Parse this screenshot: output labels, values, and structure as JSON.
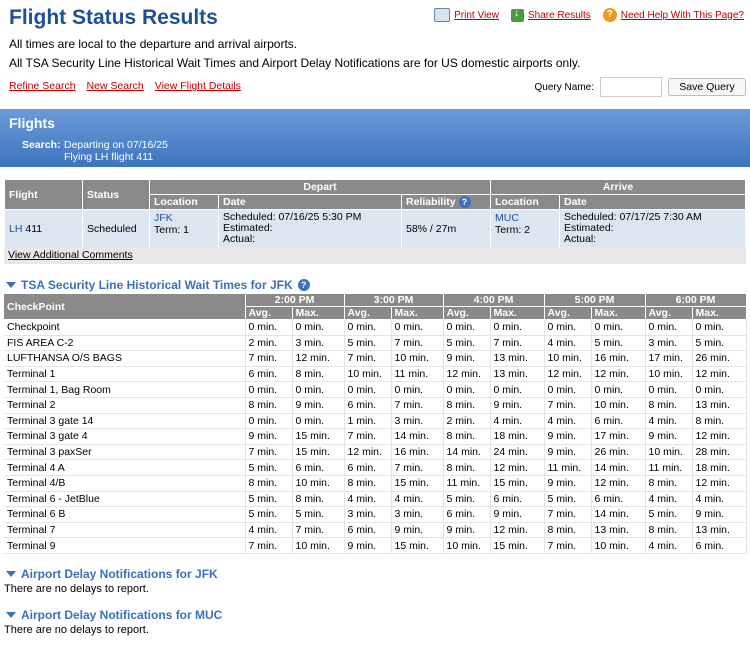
{
  "header": {
    "title": "Flight Status Results",
    "print_label": "Print View",
    "share_label": "Share Results",
    "help_label": "Need Help With This Page?",
    "note1": "All times are local to the departure and arrival airports.",
    "note2": "All TSA Security Line Historical Wait Times and Airport Delay Notifications are for US domestic airports only."
  },
  "actions": {
    "refine": "Refine Search",
    "new": "New Search",
    "details": "View Flight Details",
    "query_label": "Query Name:",
    "query_value": "",
    "save_label": "Save Query"
  },
  "flights_panel": {
    "title": "Flights",
    "search_label": "Search:",
    "search_line1": "Departing on 07/16/25",
    "search_line2": "Flying LH flight 411"
  },
  "flight_table": {
    "headers": {
      "flight": "Flight",
      "status": "Status",
      "depart": "Depart",
      "arrive": "Arrive",
      "location": "Location",
      "date": "Date",
      "reliability": "Reliability"
    },
    "row": {
      "airline": "LH",
      "number": "411",
      "status": "Scheduled",
      "dep_airport": "JFK",
      "dep_term": "Term: 1",
      "dep_scheduled": "Scheduled:  07/16/25 5:30 PM",
      "dep_estimated": "Estimated:",
      "dep_actual": "Actual:",
      "reliability": "58% / 27m",
      "arr_airport": "MUC",
      "arr_term": "Term: 2",
      "arr_scheduled": "Scheduled:  07/17/25 7:30 AM",
      "arr_estimated": "Estimated:",
      "arr_actual": "Actual:"
    },
    "comments_link": "View Additional Comments"
  },
  "tsa": {
    "title": "TSA Security Line Historical Wait Times for JFK",
    "checkpoint_header": "CheckPoint",
    "avg_label": "Avg.",
    "max_label": "Max.",
    "times": [
      "2:00 PM",
      "3:00 PM",
      "4:00 PM",
      "5:00 PM",
      "6:00 PM"
    ],
    "rows": [
      {
        "name": "Checkpoint",
        "vals": [
          "0 min.",
          "0 min.",
          "0 min.",
          "0 min.",
          "0 min.",
          "0 min.",
          "0 min.",
          "0 min.",
          "0 min.",
          "0 min."
        ]
      },
      {
        "name": "FIS AREA C-2",
        "vals": [
          "2 min.",
          "3 min.",
          "5 min.",
          "7 min.",
          "5 min.",
          "7 min.",
          "4 min.",
          "5 min.",
          "3 min.",
          "5 min."
        ]
      },
      {
        "name": "LUFTHANSA O/S BAGS",
        "vals": [
          "7 min.",
          "12 min.",
          "7 min.",
          "10 min.",
          "9 min.",
          "13 min.",
          "10 min.",
          "16 min.",
          "17 min.",
          "26 min."
        ]
      },
      {
        "name": "Terminal 1",
        "vals": [
          "6 min.",
          "8 min.",
          "10 min.",
          "11 min.",
          "12 min.",
          "13 min.",
          "12 min.",
          "12 min.",
          "10 min.",
          "12 min."
        ]
      },
      {
        "name": "Terminal 1, Bag Room",
        "vals": [
          "0 min.",
          "0 min.",
          "0 min.",
          "0 min.",
          "0 min.",
          "0 min.",
          "0 min.",
          "0 min.",
          "0 min.",
          "0 min."
        ]
      },
      {
        "name": "Terminal 2",
        "vals": [
          "8 min.",
          "9 min.",
          "6 min.",
          "7 min.",
          "8 min.",
          "9 min.",
          "7 min.",
          "10 min.",
          "8 min.",
          "13 min."
        ]
      },
      {
        "name": "Terminal 3 gate 14",
        "vals": [
          "0 min.",
          "0 min.",
          "1 min.",
          "3 min.",
          "2 min.",
          "4 min.",
          "4 min.",
          "6 min.",
          "4 min.",
          "8 min."
        ]
      },
      {
        "name": "Terminal 3 gate 4",
        "vals": [
          "9 min.",
          "15 min.",
          "7 min.",
          "14 min.",
          "8 min.",
          "18 min.",
          "9 min.",
          "17 min.",
          "9 min.",
          "12 min."
        ]
      },
      {
        "name": "Terminal 3 paxSer",
        "vals": [
          "7 min.",
          "15 min.",
          "12 min.",
          "16 min.",
          "14 min.",
          "24 min.",
          "9 min.",
          "26 min.",
          "10 min.",
          "28 min."
        ]
      },
      {
        "name": "Terminal 4 A",
        "vals": [
          "5 min.",
          "6 min.",
          "6 min.",
          "7 min.",
          "8 min.",
          "12 min.",
          "11 min.",
          "14 min.",
          "11 min.",
          "18 min."
        ]
      },
      {
        "name": "Terminal 4/B",
        "vals": [
          "8 min.",
          "10 min.",
          "8 min.",
          "15 min.",
          "11 min.",
          "15 min.",
          "9 min.",
          "12 min.",
          "8 min.",
          "12 min."
        ]
      },
      {
        "name": "Terminal 6 - JetBlue",
        "vals": [
          "5 min.",
          "8 min.",
          "4 min.",
          "4 min.",
          "5 min.",
          "6 min.",
          "5 min.",
          "6 min.",
          "4 min.",
          "4 min."
        ]
      },
      {
        "name": "Terminal 6 B",
        "vals": [
          "5 min.",
          "5 min.",
          "3 min.",
          "3 min.",
          "6 min.",
          "9 min.",
          "7 min.",
          "14 min.",
          "5 min.",
          "9 min."
        ]
      },
      {
        "name": "Terminal 7",
        "vals": [
          "4 min.",
          "7 min.",
          "6 min.",
          "9 min.",
          "9 min.",
          "12 min.",
          "8 min.",
          "13 min.",
          "8 min.",
          "13 min."
        ]
      },
      {
        "name": "Terminal 9",
        "vals": [
          "7 min.",
          "10 min.",
          "9 min.",
          "15 min.",
          "10 min.",
          "15 min.",
          "7 min.",
          "10 min.",
          "4 min.",
          "6 min."
        ]
      }
    ]
  },
  "delays": {
    "jfk_title": "Airport Delay Notifications for JFK",
    "jfk_text": "There are no delays to report.",
    "muc_title": "Airport Delay Notifications for MUC",
    "muc_text": "There are no delays to report."
  }
}
